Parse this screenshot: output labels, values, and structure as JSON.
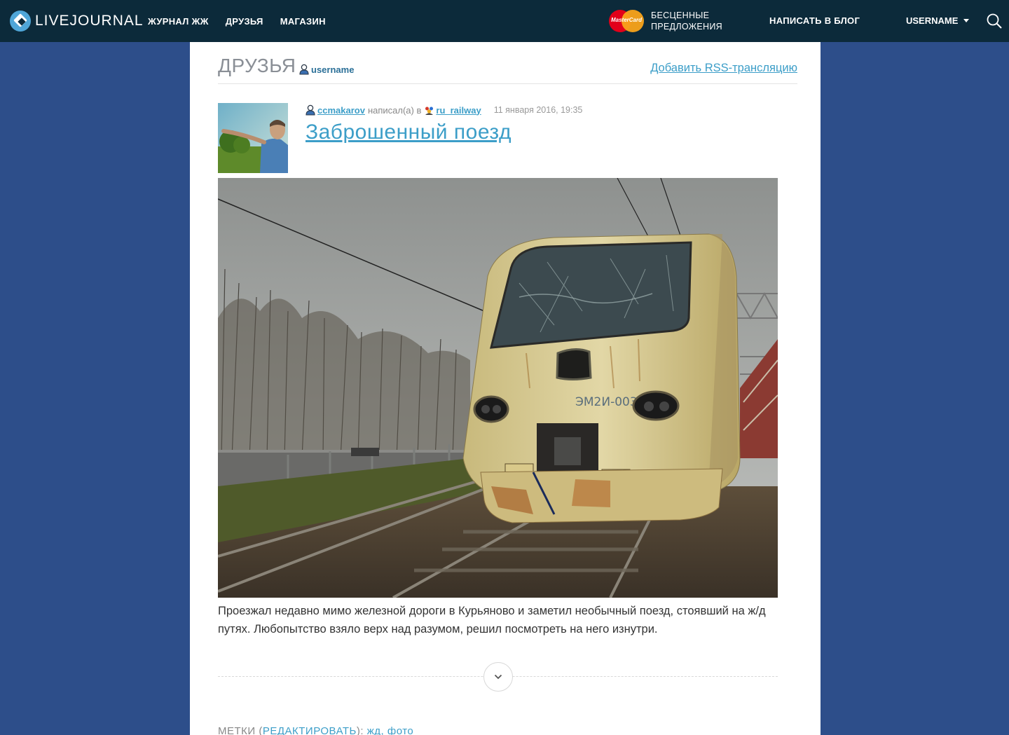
{
  "header": {
    "logo_text": "LIVEJOURNAL",
    "nav": [
      "ЖУРНАЛ ЖЖ",
      "ДРУЗЬЯ",
      "МАГАЗИН"
    ],
    "promo_brand": "MasterCard",
    "promo_line1": "БЕСЦЕННЫЕ",
    "promo_line2": "ПРЕДЛОЖЕНИЯ",
    "write_label": "НАПИСАТЬ В БЛОГ",
    "username_label": "USERNAME"
  },
  "page": {
    "title": "ДРУЗЬЯ",
    "owner": "username",
    "rss_link": "Добавить RSS-трансляцию"
  },
  "post": {
    "author": "ccmakarov",
    "wrote_in": "написал(а) в",
    "community": "ru_railway",
    "date": "11 января 2016, 19:35",
    "title": "Заброшенный поезд",
    "train_label": "ЭМ2И-003",
    "text": "Проезжал недавно мимо железной дороги в Курьяново и заметил необычный поезд, стоявший на ж/д путях. Любопытство взяло верх над разумом, решил посмотреть на него изнутри.",
    "tags_label": "МЕТКИ",
    "tags_edit": "РЕДАКТИРОВАТЬ",
    "tags": "жд, фото"
  },
  "colors": {
    "topbar": "#0c2a3a",
    "background": "#2d4e8a",
    "link": "#3c9ec8"
  }
}
